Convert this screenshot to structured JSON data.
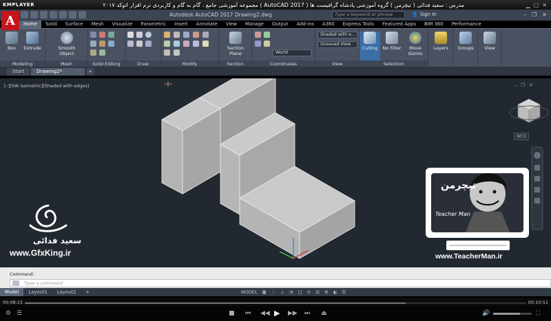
{
  "player": {
    "logo": "KMPLAYER",
    "title": "مجموعه آموزشی جامع ، گام به گام و کاربردی نرم افزار اتوکد ۲۰۱۷ ( AutoCAD 2017 ) مدرس : سعید فدائی ( تیچرمن ) گروه آموزشی پادشاه گرافیست ها",
    "time_current": "00:08:15",
    "time_total": "00:10:51",
    "progress": 0.76
  },
  "app": {
    "title": "Autodesk AutoCAD 2017    Drawing2.dwg",
    "search_placeholder": "Type a keyword or phrase",
    "sign_in": "Sign In"
  },
  "ribbon": {
    "tabs": [
      "Home",
      "Solid",
      "Surface",
      "Mesh",
      "Visualize",
      "Parametric",
      "Insert",
      "Annotate",
      "View",
      "Manage",
      "Output",
      "Add-ins",
      "A360",
      "Express Tools",
      "Featured Apps",
      "BIM 360",
      "Performance"
    ],
    "active_tab": "Home",
    "panels": {
      "modeling": "Modeling",
      "mesh": "Mesh",
      "solid_editing": "Solid Editing",
      "draw": "Draw",
      "modify": "Modify",
      "section": "Section",
      "coordinates": "Coordinates",
      "view": "View",
      "selection": "Selection"
    },
    "buttons": {
      "box": "Box",
      "extrude": "Extrude",
      "smooth_object": "Smooth Object",
      "section_plane": "Section Plane",
      "culling": "Culling",
      "no_filter": "No Filter",
      "move_gizmo": "Move Gizmo",
      "layers": "Layers",
      "groups": "Groups",
      "view": "View"
    },
    "dropdowns": {
      "visual_style": "Shaded with e...",
      "view_saved": "Unsaved View",
      "ucs": "World"
    }
  },
  "file_tabs": [
    "Start",
    "Drawing2*"
  ],
  "viewport": {
    "label": "[–][SW Isometric][Shaded with edges]",
    "wcs": "WCS"
  },
  "command": {
    "history": "Command:",
    "placeholder": "Type a command"
  },
  "layout_tabs": [
    "Model",
    "Layout1",
    "Layout2"
  ],
  "status": {
    "model": "MODEL"
  },
  "watermarks": {
    "author_fa": "سعید فدائی",
    "gfxking": "www.GfxKing.ir",
    "teacherman_url": "www.TeacherMan.ir",
    "teacherman_logo_fa": "تیچرمن",
    "teacherman_logo_en": "Teacher Man"
  },
  "colors": {
    "accent": "#c4161c",
    "ribbon": "#4a5262",
    "viewport": "#212830"
  }
}
